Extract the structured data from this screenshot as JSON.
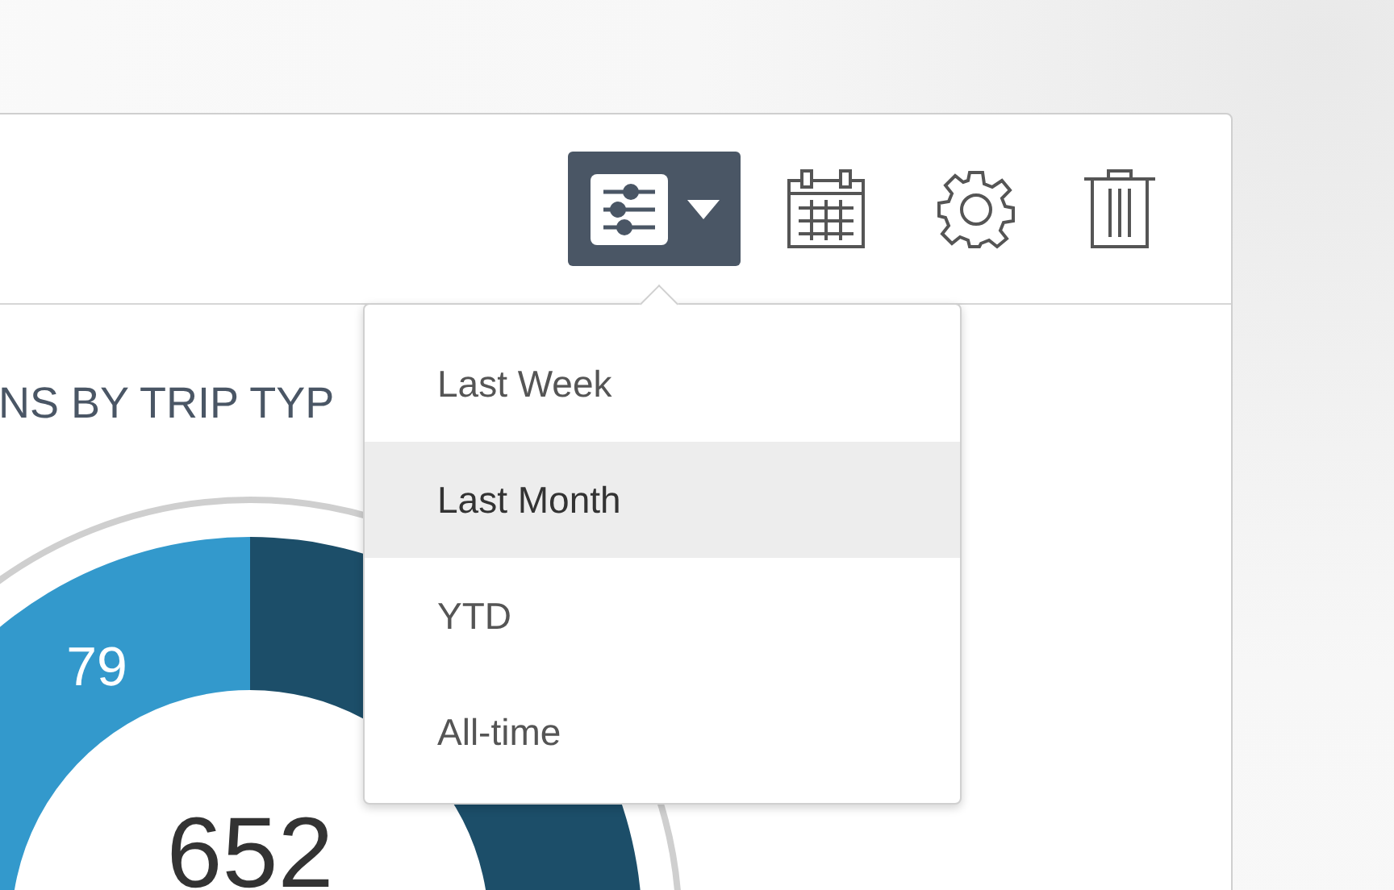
{
  "chart_card": {
    "title": "NS BY TRIP TYP",
    "donut": {
      "segment_label": "79",
      "total": "652"
    }
  },
  "filter_menu": {
    "open": true,
    "items": [
      {
        "label": "Last Week",
        "selected": false
      },
      {
        "label": "Last Month",
        "selected": true
      },
      {
        "label": "YTD",
        "selected": false
      },
      {
        "label": "All-time",
        "selected": false
      }
    ]
  }
}
